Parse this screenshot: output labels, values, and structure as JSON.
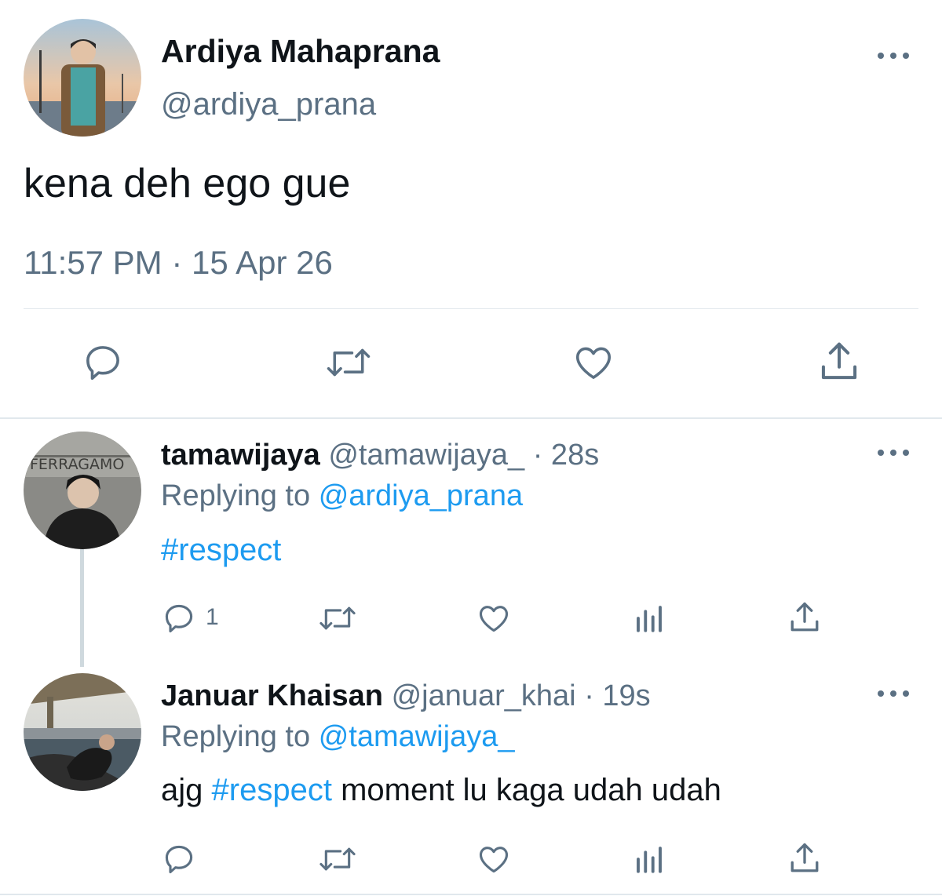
{
  "main_tweet": {
    "name": "Ardiya Mahaprana",
    "handle": "@ardiya_prana",
    "text": "kena deh ego gue",
    "time": "11:57 PM",
    "dot": "·",
    "date": "15 Apr 26"
  },
  "replies": [
    {
      "name": "tamawijaya",
      "handle": "@tamawijaya_",
      "time": "· 28s",
      "replying_prefix": "Replying to",
      "replying_to": "@ardiya_prana",
      "hashtag": "#respect",
      "reply_count": "1",
      "avatar_text": "FERRAGAMO"
    },
    {
      "name": "Januar Khaisan",
      "handle": "@januar_khai",
      "time": "· 19s",
      "replying_prefix": "Replying to",
      "replying_to": "@tamawijaya_",
      "text_before": "ajg",
      "hashtag": "#respect",
      "text_after": "moment lu kaga udah udah"
    }
  ],
  "colors": {
    "text": "#0f1419",
    "secondary": "#5b7083",
    "link": "#1d9bf0",
    "divider": "#e1e8ed",
    "thread_line": "#cfd9de"
  },
  "icons": [
    "more-icon",
    "reply-icon",
    "retweet-icon",
    "like-icon",
    "share-icon",
    "analytics-icon"
  ]
}
